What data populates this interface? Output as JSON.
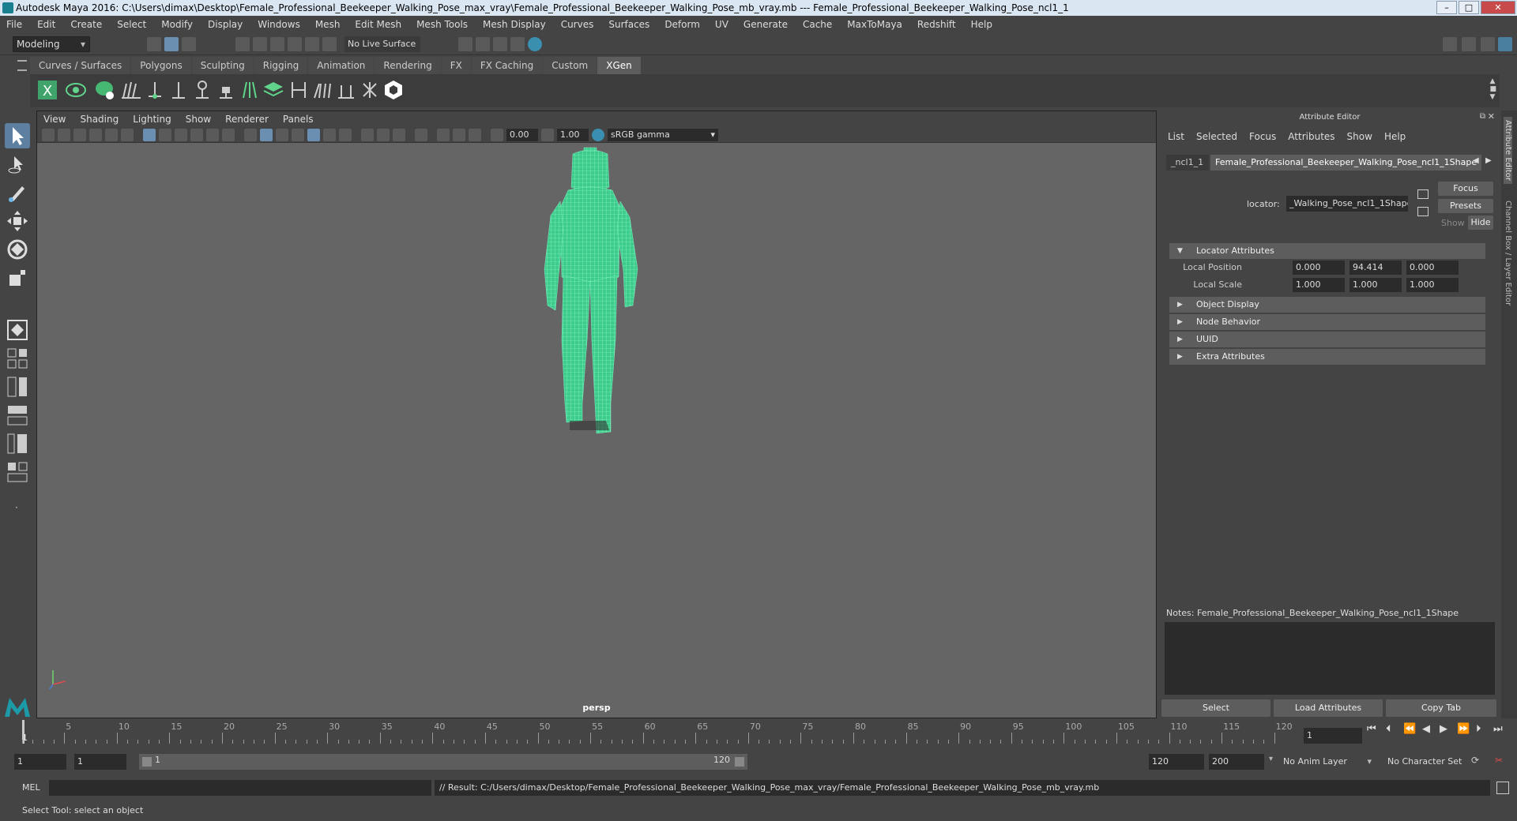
{
  "window": {
    "title": "Autodesk Maya 2016: C:\\Users\\dimax\\Desktop\\Female_Professional_Beekeeper_Walking_Pose_max_vray\\Female_Professional_Beekeeper_Walking_Pose_mb_vray.mb   ---   Female_Professional_Beekeeper_Walking_Pose_ncl1_1",
    "minimize": "–",
    "maximize": "□",
    "close": "✕"
  },
  "menubar": [
    "File",
    "Edit",
    "Create",
    "Select",
    "Modify",
    "Display",
    "Windows",
    "Mesh",
    "Edit Mesh",
    "Mesh Tools",
    "Mesh Display",
    "Curves",
    "Surfaces",
    "Deform",
    "UV",
    "Generate",
    "Cache",
    "MaxToMaya",
    "Redshift",
    "Help"
  ],
  "statusline": {
    "mode": "Modeling",
    "live_surface": "No Live Surface"
  },
  "shelf_tabs": [
    "Curves / Surfaces",
    "Polygons",
    "Sculpting",
    "Rigging",
    "Animation",
    "Rendering",
    "FX",
    "FX Caching",
    "Custom",
    "XGen"
  ],
  "viewport": {
    "menu": [
      "View",
      "Shading",
      "Lighting",
      "Show",
      "Renderer",
      "Panels"
    ],
    "exposure": "0.00",
    "gamma": "1.00",
    "color_space": "sRGB gamma",
    "camera_label": "persp"
  },
  "attribute_editor": {
    "title": "Attribute Editor",
    "menu": [
      "List",
      "Selected",
      "Focus",
      "Attributes",
      "Show",
      "Help"
    ],
    "tab_prev": "_ncl1_1",
    "tab_active": "Female_Professional_Beekeeper_Walking_Pose_ncl1_1Shape",
    "locator_label": "locator:",
    "locator_value": "_Walking_Pose_ncl1_1Shape",
    "focus_btn": "Focus",
    "presets_btn": "Presets",
    "show_btn": "Show",
    "hide_btn": "Hide",
    "sections": {
      "locator_attributes": "Locator Attributes",
      "object_display": "Object Display",
      "node_behavior": "Node Behavior",
      "uuid": "UUID",
      "extra_attributes": "Extra Attributes"
    },
    "local_position_label": "Local Position",
    "local_position": [
      "0.000",
      "94.414",
      "0.000"
    ],
    "local_scale_label": "Local Scale",
    "local_scale": [
      "1.000",
      "1.000",
      "1.000"
    ],
    "notes": "Notes:  Female_Professional_Beekeeper_Walking_Pose_ncl1_1Shape",
    "select_btn": "Select",
    "load_btn": "Load Attributes",
    "copy_btn": "Copy Tab"
  },
  "side_tabs": {
    "attribute_editor": "Attribute Editor",
    "channel_box": "Channel Box / Layer Editor"
  },
  "timeline": {
    "ticks": [
      "5",
      "10",
      "15",
      "20",
      "25",
      "30",
      "35",
      "40",
      "45",
      "50",
      "55",
      "60",
      "65",
      "70",
      "75",
      "80",
      "85",
      "90",
      "95",
      "100",
      "105",
      "110",
      "115",
      "120"
    ],
    "start_marker": "1",
    "current_frame": "1"
  },
  "range": {
    "start": "1",
    "playback_start": "1",
    "slider_start": "1",
    "slider_end": "120",
    "playback_end": "120",
    "end": "200",
    "anim_layer": "No Anim Layer",
    "character_set": "No Character Set"
  },
  "command": {
    "language": "MEL",
    "result": "// Result: C:/Users/dimax/Desktop/Female_Professional_Beekeeper_Walking_Pose_max_vray/Female_Professional_Beekeeper_Walking_Pose_mb_vray.mb"
  },
  "status_help": "Select Tool: select an object",
  "colors": {
    "wireframe": "#4fe8a8",
    "viewport_bg": "#656565",
    "panel_bg": "#444444"
  }
}
